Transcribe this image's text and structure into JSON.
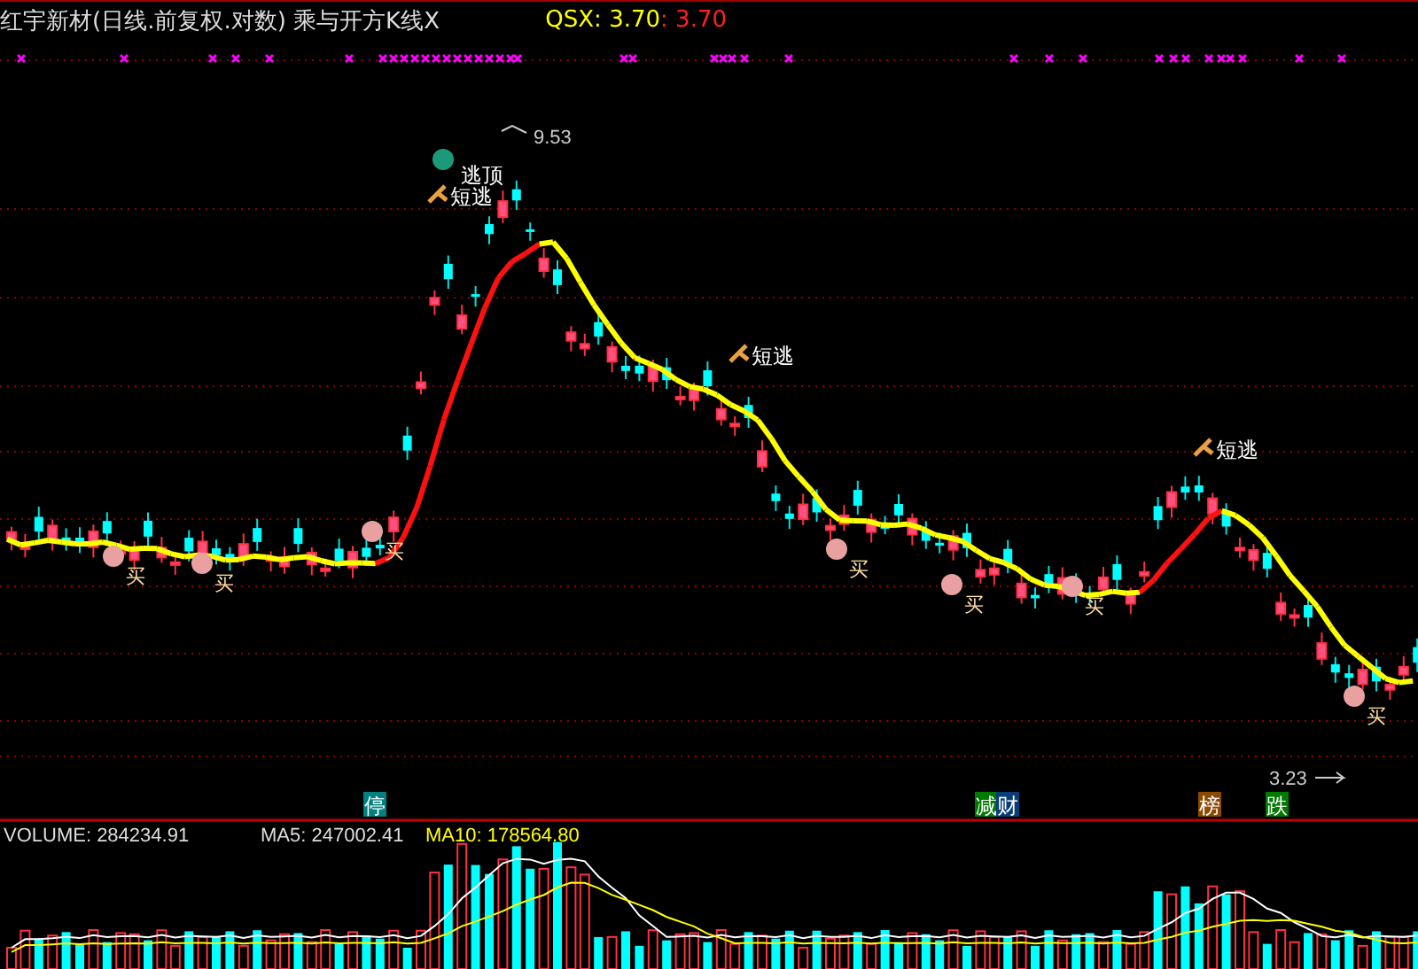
{
  "header": {
    "title": "红宇新材(日线.前复权.对数) 乘与开方K线X",
    "qsx": "QSX: 3.70",
    "qsx_alt": ": 3.70"
  },
  "price_chart": {
    "high_label": "9.53",
    "low_label": "3.23",
    "signals": [
      {
        "kind": "top",
        "text": "逃顶"
      },
      {
        "kind": "sell",
        "text": "短逃"
      },
      {
        "kind": "sell",
        "text": "短逃"
      },
      {
        "kind": "sell",
        "text": "短逃"
      },
      {
        "kind": "buy",
        "text": "买"
      },
      {
        "kind": "buy",
        "text": "买"
      },
      {
        "kind": "buy",
        "text": "买"
      },
      {
        "kind": "buy",
        "text": "买"
      },
      {
        "kind": "buy",
        "text": "买"
      },
      {
        "kind": "buy",
        "text": "买"
      },
      {
        "kind": "buy",
        "text": "买"
      }
    ],
    "tags": [
      {
        "text": "停",
        "color": "#008080"
      },
      {
        "text": "减",
        "color": "#007a00"
      },
      {
        "text": "财",
        "color": "#0a3c78"
      },
      {
        "text": "榜",
        "color": "#8b4a00"
      },
      {
        "text": "跌",
        "color": "#007a00"
      }
    ]
  },
  "volume": {
    "label": "VOLUME: 284234.91",
    "ma5": "MA5: 247002.41",
    "ma10": "MA10: 178564.80"
  }
}
